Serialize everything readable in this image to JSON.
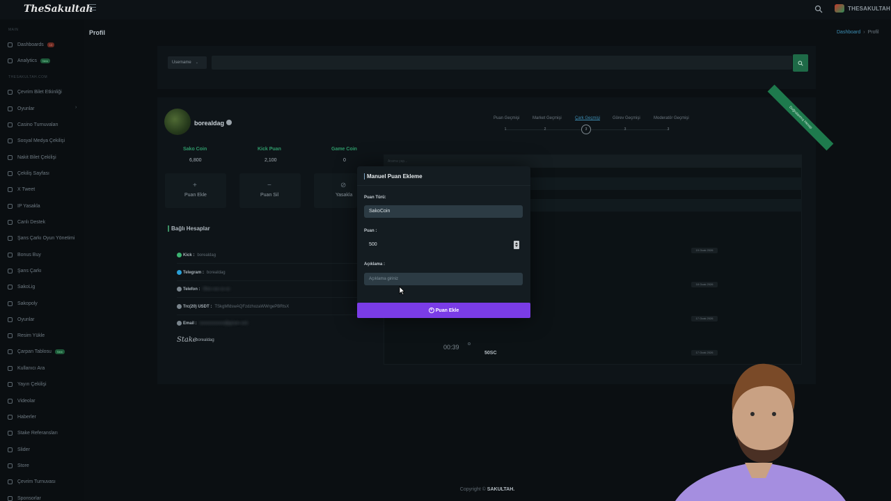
{
  "header": {
    "logo": "TheSakultah",
    "username": "THESAKULTAH"
  },
  "sidebar": {
    "section_main": "MAIN",
    "section_brand": "THESAKULTAH.COM",
    "items": [
      {
        "label": "Dashboards",
        "badge": "13",
        "badge_color": "red"
      },
      {
        "label": "Analytics",
        "badge": "New",
        "badge_color": "green"
      },
      {
        "label": "Çevrim Bilet Etkinliği"
      },
      {
        "label": "Oyunlar"
      },
      {
        "label": "Casino Turnuvaları"
      },
      {
        "label": "Sosyal Medya Çekilişi"
      },
      {
        "label": "Nakit Bilet Çekilişi"
      },
      {
        "label": "Çekiliş Sayfası"
      },
      {
        "label": "X Tweet"
      },
      {
        "label": "IP Yasakla"
      },
      {
        "label": "Canlı Destek"
      },
      {
        "label": "Şans Çarkı Oyun Yönetimi"
      },
      {
        "label": "Bonus Buy"
      },
      {
        "label": "Şans Çarkı"
      },
      {
        "label": "SakoLig"
      },
      {
        "label": "Sakopoly"
      },
      {
        "label": "Oyunlar"
      },
      {
        "label": "Resim Yükle"
      },
      {
        "label": "Çarpan Tablosu",
        "badge": "New",
        "badge_color": "green"
      },
      {
        "label": "Kullanıcı Ara"
      },
      {
        "label": "Yayın Çekilişi"
      },
      {
        "label": "Videolar"
      },
      {
        "label": "Haberler"
      },
      {
        "label": "Stake Referansları"
      },
      {
        "label": "Slider"
      },
      {
        "label": "Store"
      },
      {
        "label": "Çevrim Turnuvası"
      },
      {
        "label": "Sponsorlar"
      }
    ]
  },
  "page": {
    "title": "Profil",
    "breadcrumb": [
      "Dashboard",
      "Profil"
    ]
  },
  "search": {
    "select_value": "Username",
    "input_value": ""
  },
  "profile": {
    "name": "borealdag",
    "stats": [
      {
        "label": "Sako Coin",
        "value": "6,800"
      },
      {
        "label": "Kick Puan",
        "value": "2,100"
      },
      {
        "label": "Game Coin",
        "value": "0"
      }
    ],
    "actions": [
      {
        "label": "Puan Ekle",
        "icon": "+"
      },
      {
        "label": "Puan Sil",
        "icon": "−"
      },
      {
        "label": "Yasakla",
        "icon": "⊘"
      }
    ],
    "linked_title": "Bağlı Hesaplar",
    "accounts": [
      {
        "key": "Kick :",
        "value": "borealdag",
        "icon_color": "#3cb371"
      },
      {
        "key": "Telegram :",
        "value": "borealdag",
        "icon_color": "#2a9fd6"
      },
      {
        "key": "Telefon :",
        "value": "",
        "icon_color": "#7a858d"
      },
      {
        "key": "Trc(20) USDT :",
        "value": "TSkgMfdswAQFzdzhozaWWrgePBRtsX",
        "icon_color": "#7a858d"
      },
      {
        "key": "Email :",
        "value": "",
        "icon_color": "#7a858d"
      }
    ],
    "stake_logo": "Stake",
    "stake_value": "borealdag",
    "ribbon": "Doğrulanmış Hesap"
  },
  "history": {
    "tabs": [
      {
        "label": "Puan Geçmişi",
        "count": "1"
      },
      {
        "label": "Market Geçmişi",
        "count": "2"
      },
      {
        "label": "Çark Geçmişi",
        "count": "3",
        "active": true
      },
      {
        "label": "Görev Geçmişi",
        "count": "3"
      },
      {
        "label": "Moderatör Geçmişi",
        "count": "3"
      }
    ],
    "search_placeholder": "Arama yap...",
    "dates": [
      "19 Ocak 2026",
      "18 Ocak 2026",
      "17 Ocak 2026",
      "17 Ocak 2026"
    ],
    "timer": "00:39",
    "last_value": "50SC"
  },
  "modal": {
    "title": "Manuel Puan Ekleme",
    "type_label": "Puan Türü:",
    "type_value": "SakoCoin",
    "amount_label": "Puan :",
    "amount_value": "500",
    "desc_label": "Açıklama :",
    "desc_placeholder": "Açıklama giriniz",
    "submit_label": "Puan Ekle",
    "accent": "#7a3ce6"
  },
  "footer": {
    "prefix": "Copyright ©",
    "brand": "SAKULTAH."
  }
}
